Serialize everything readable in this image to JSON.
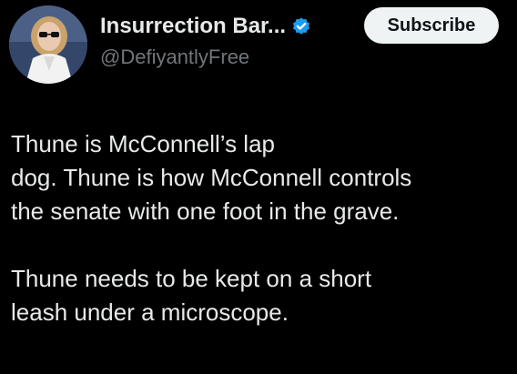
{
  "author": {
    "display_name": "Insurrection Bar...",
    "handle": "@DefiyantlyFree",
    "verified_icon": "verified-badge-icon",
    "verified_color": "#1d9bf0"
  },
  "actions": {
    "subscribe_label": "Subscribe"
  },
  "tweet": {
    "paragraphs": [
      {
        "lines": [
          "Thune is McConnell’s lap",
          "dog. Thune is how McConnell controls",
          "the senate with one foot in the grave."
        ]
      },
      {
        "lines": [
          "Thune needs to be kept on a short",
          "leash under a microscope."
        ]
      }
    ]
  },
  "colors": {
    "background": "#000000",
    "text": "#e7e9ea",
    "secondary_text": "#71767b",
    "button_bg": "#eff3f4"
  }
}
